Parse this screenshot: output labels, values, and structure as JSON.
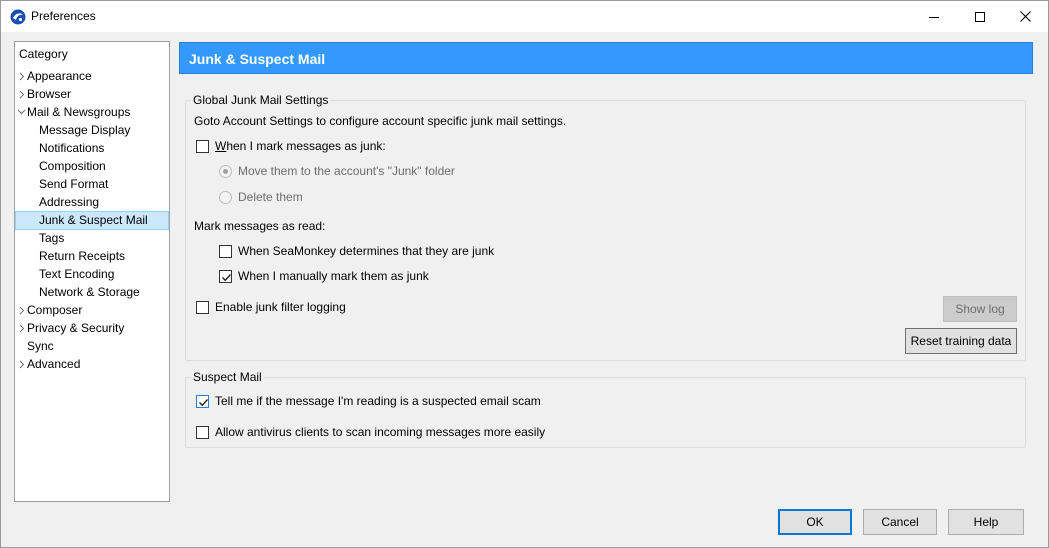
{
  "window": {
    "title": "Preferences"
  },
  "category": {
    "header": "Category",
    "items": [
      {
        "label": "Appearance",
        "level": 0,
        "arrow": "collapsed"
      },
      {
        "label": "Browser",
        "level": 0,
        "arrow": "collapsed"
      },
      {
        "label": "Mail & Newsgroups",
        "level": 0,
        "arrow": "expanded"
      },
      {
        "label": "Message Display",
        "level": 1
      },
      {
        "label": "Notifications",
        "level": 1
      },
      {
        "label": "Composition",
        "level": 1
      },
      {
        "label": "Send Format",
        "level": 1
      },
      {
        "label": "Addressing",
        "level": 1
      },
      {
        "label": "Junk & Suspect Mail",
        "level": 1,
        "selected": true
      },
      {
        "label": "Tags",
        "level": 1
      },
      {
        "label": "Return Receipts",
        "level": 1
      },
      {
        "label": "Text Encoding",
        "level": 1
      },
      {
        "label": "Network & Storage",
        "level": 1
      },
      {
        "label": "Composer",
        "level": 0,
        "arrow": "collapsed"
      },
      {
        "label": "Privacy & Security",
        "level": 0,
        "arrow": "collapsed"
      },
      {
        "label": "Sync",
        "level": 0
      },
      {
        "label": "Advanced",
        "level": 0,
        "arrow": "collapsed"
      }
    ]
  },
  "pane": {
    "title": "Junk & Suspect Mail",
    "global": {
      "legend": "Global Junk Mail Settings",
      "info": "Goto Account Settings to configure account specific junk mail settings.",
      "mark_junk": {
        "label": "When I mark messages as junk:",
        "checked": false
      },
      "move_option": "Move them to the account's \"Junk\" folder",
      "delete_option": "Delete them",
      "mark_read_label": "Mark messages as read:",
      "read_auto": {
        "label": "When SeaMonkey determines that they are junk",
        "checked": false
      },
      "read_manual": {
        "label": "When I manually mark them as junk",
        "checked": true
      },
      "logging": {
        "label": "Enable junk filter logging",
        "checked": false
      },
      "show_log": "Show log",
      "reset_training": "Reset training data"
    },
    "suspect": {
      "legend": "Suspect Mail",
      "scam": {
        "label": "Tell me if the message I'm reading is a suspected email scam",
        "checked": true
      },
      "antivirus": {
        "label": "Allow antivirus clients to scan incoming messages more easily",
        "checked": false
      }
    }
  },
  "buttons": {
    "ok": "OK",
    "cancel": "Cancel",
    "help": "Help"
  },
  "colors": {
    "header_bg": "#3399ff",
    "selection_bg": "#cce8ff",
    "default_button_border": "#0078d7"
  }
}
